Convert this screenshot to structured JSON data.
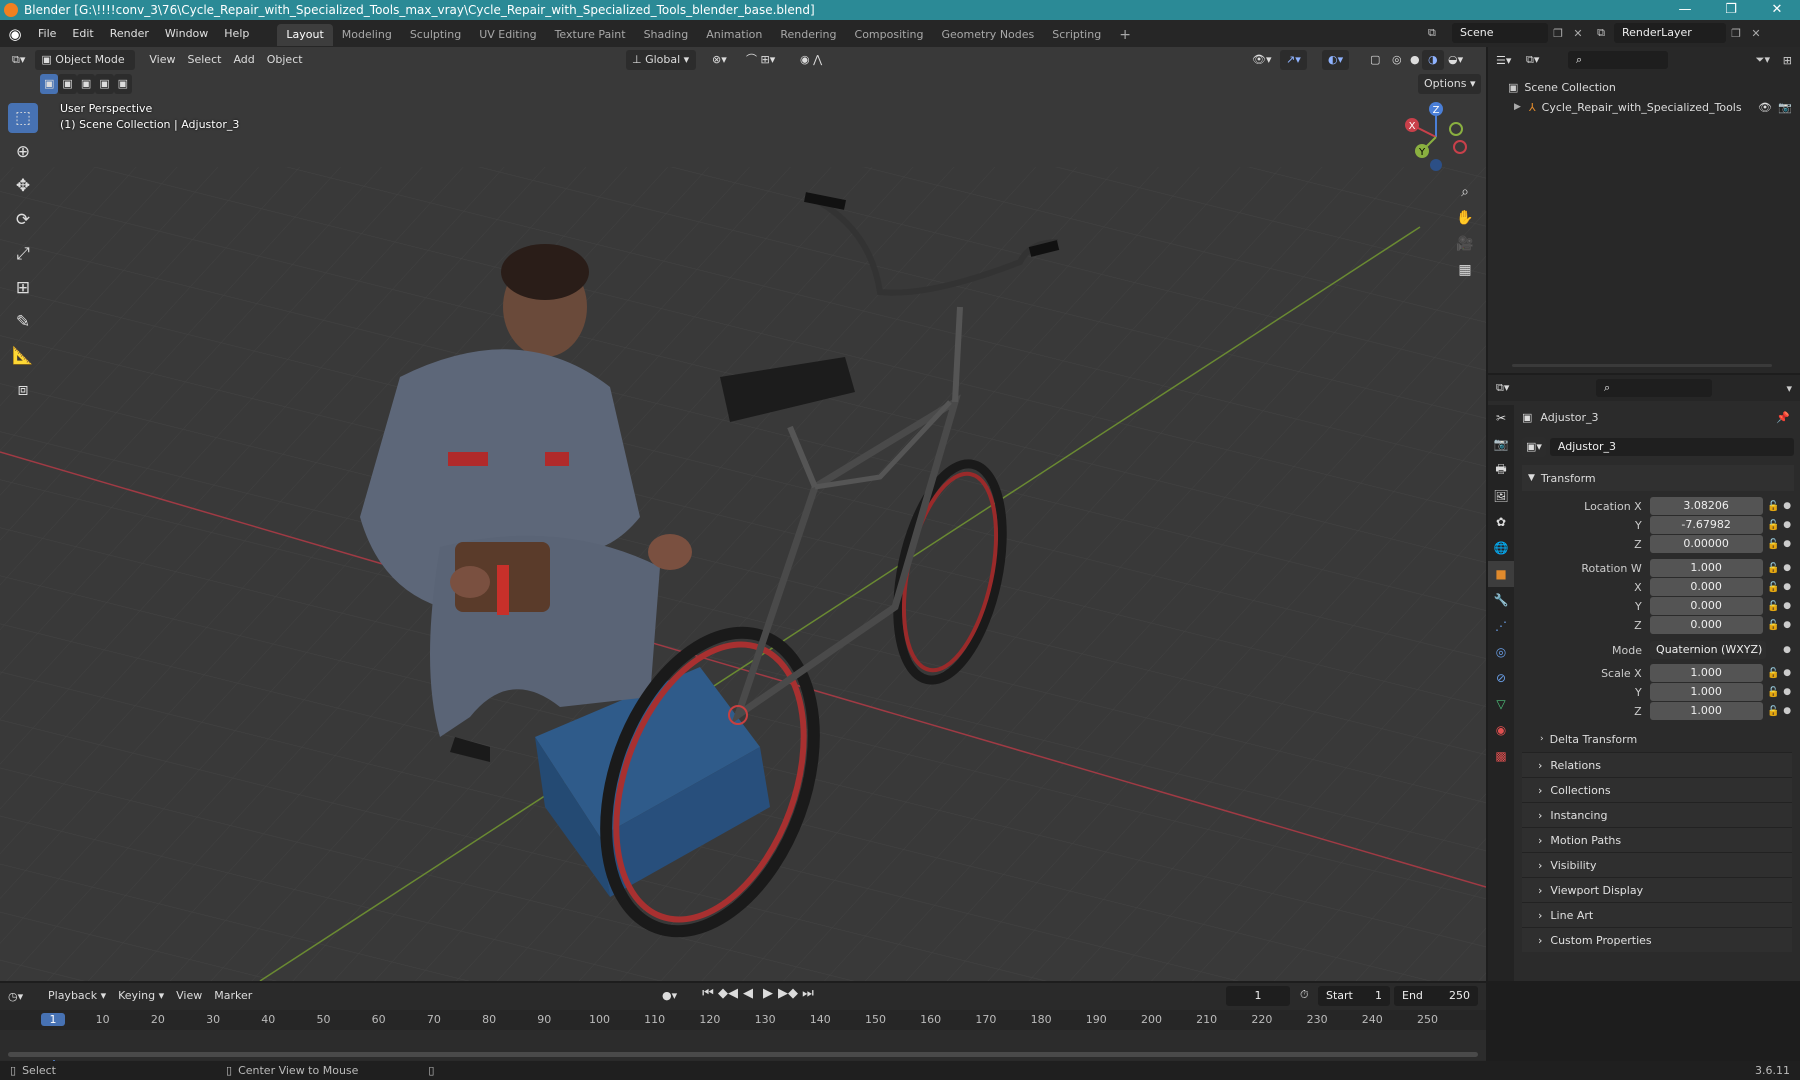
{
  "titlebar": {
    "title": "Blender [G:\\!!!!conv_3\\76\\Cycle_Repair_with_Specialized_Tools_max_vray\\Cycle_Repair_with_Specialized_Tools_blender_base.blend]",
    "minimize": "—",
    "maximize": "❐",
    "close": "✕"
  },
  "menubar": {
    "menus": [
      "File",
      "Edit",
      "Render",
      "Window",
      "Help"
    ],
    "workspaces": [
      "Layout",
      "Modeling",
      "Sculpting",
      "UV Editing",
      "Texture Paint",
      "Shading",
      "Animation",
      "Rendering",
      "Compositing",
      "Geometry Nodes",
      "Scripting"
    ],
    "active_workspace": "Layout",
    "add_tab": "+",
    "scene": "Scene",
    "view_layer": "RenderLayer"
  },
  "viewport": {
    "mode": "Object Mode",
    "menus": [
      "View",
      "Select",
      "Add",
      "Object"
    ],
    "orientation": "Global",
    "options": "Options",
    "overlay_line1": "User Perspective",
    "overlay_line2": "(1) Scene Collection | Adjustor_3",
    "gizmo": {
      "x": "X",
      "y": "Y",
      "z": "Z"
    }
  },
  "outliner": {
    "root": "Scene Collection",
    "items": [
      {
        "label": "Cycle_Repair_with_Specialized_Tools"
      }
    ]
  },
  "properties": {
    "object_name": "Adjustor_3",
    "data_name": "Adjustor_3",
    "transform_title": "Transform",
    "location": {
      "label_x": "Location X",
      "x": "3.08206",
      "y": "-7.67982",
      "z": "0.00000"
    },
    "rotation": {
      "label_w": "Rotation W",
      "w": "1.000",
      "x": "0.000",
      "y": "0.000",
      "z": "0.000"
    },
    "mode_label": "Mode",
    "mode_value": "Quaternion (WXYZ)",
    "scale": {
      "label_x": "Scale X",
      "x": "1.000",
      "y": "1.000",
      "z": "1.000"
    },
    "axis_labels": {
      "x": "X",
      "y": "Y",
      "z": "Z"
    },
    "delta": "Delta Transform",
    "sections": [
      "Relations",
      "Collections",
      "Instancing",
      "Motion Paths",
      "Visibility",
      "Viewport Display",
      "Line Art",
      "Custom Properties"
    ]
  },
  "timeline": {
    "menus": [
      "Playback",
      "Keying",
      "View",
      "Marker"
    ],
    "current_frame": "1",
    "start_label": "Start",
    "start": "1",
    "end_label": "End",
    "end": "250",
    "ticks": [
      "1",
      "10",
      "20",
      "30",
      "40",
      "50",
      "60",
      "70",
      "80",
      "90",
      "100",
      "110",
      "120",
      "130",
      "140",
      "150",
      "160",
      "170",
      "180",
      "190",
      "200",
      "210",
      "220",
      "230",
      "240",
      "250"
    ]
  },
  "statusbar": {
    "left": "Select",
    "middle": "Center View to Mouse",
    "version": "3.6.11"
  },
  "colors": {
    "accent": "#4772b3",
    "titlebar": "#2b8a96",
    "axis_x": "#c8404a",
    "axis_y": "#8ab040",
    "axis_z": "#4a7fd8",
    "frame_marker": "#4772b3"
  }
}
